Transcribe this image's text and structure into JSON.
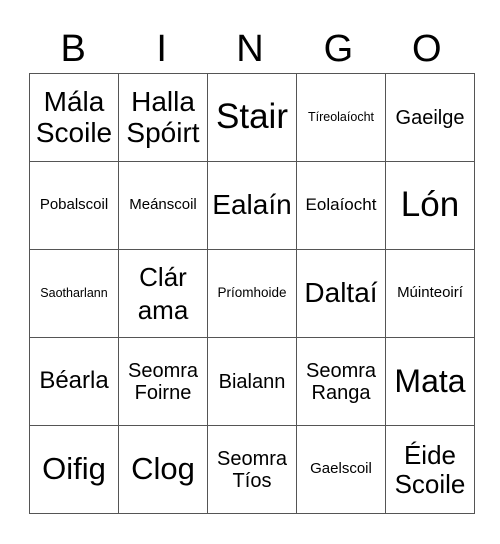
{
  "header": {
    "letters": [
      "B",
      "I",
      "N",
      "G",
      "O"
    ]
  },
  "grid": {
    "rows": [
      [
        "Mála\nScoile",
        "Halla\nSpóirt",
        "Stair",
        "Tíreolaíocht",
        "Gaeilge"
      ],
      [
        "Pobalscoil",
        "Meánscoil",
        "Ealaín",
        "Eolaíocht",
        "Lón"
      ],
      [
        "Saotharlann",
        "Clár\nama",
        "Príomhoide",
        "Daltaí",
        "Múinteoirí"
      ],
      [
        "Béarla",
        "Seomra\nFoirne",
        "Bialann",
        "Seomra\nRanga",
        "Mata"
      ],
      [
        "Oifig",
        "Clog",
        "Seomra\nTíos",
        "Gaelscoil",
        "Éide\nScoile"
      ]
    ]
  }
}
